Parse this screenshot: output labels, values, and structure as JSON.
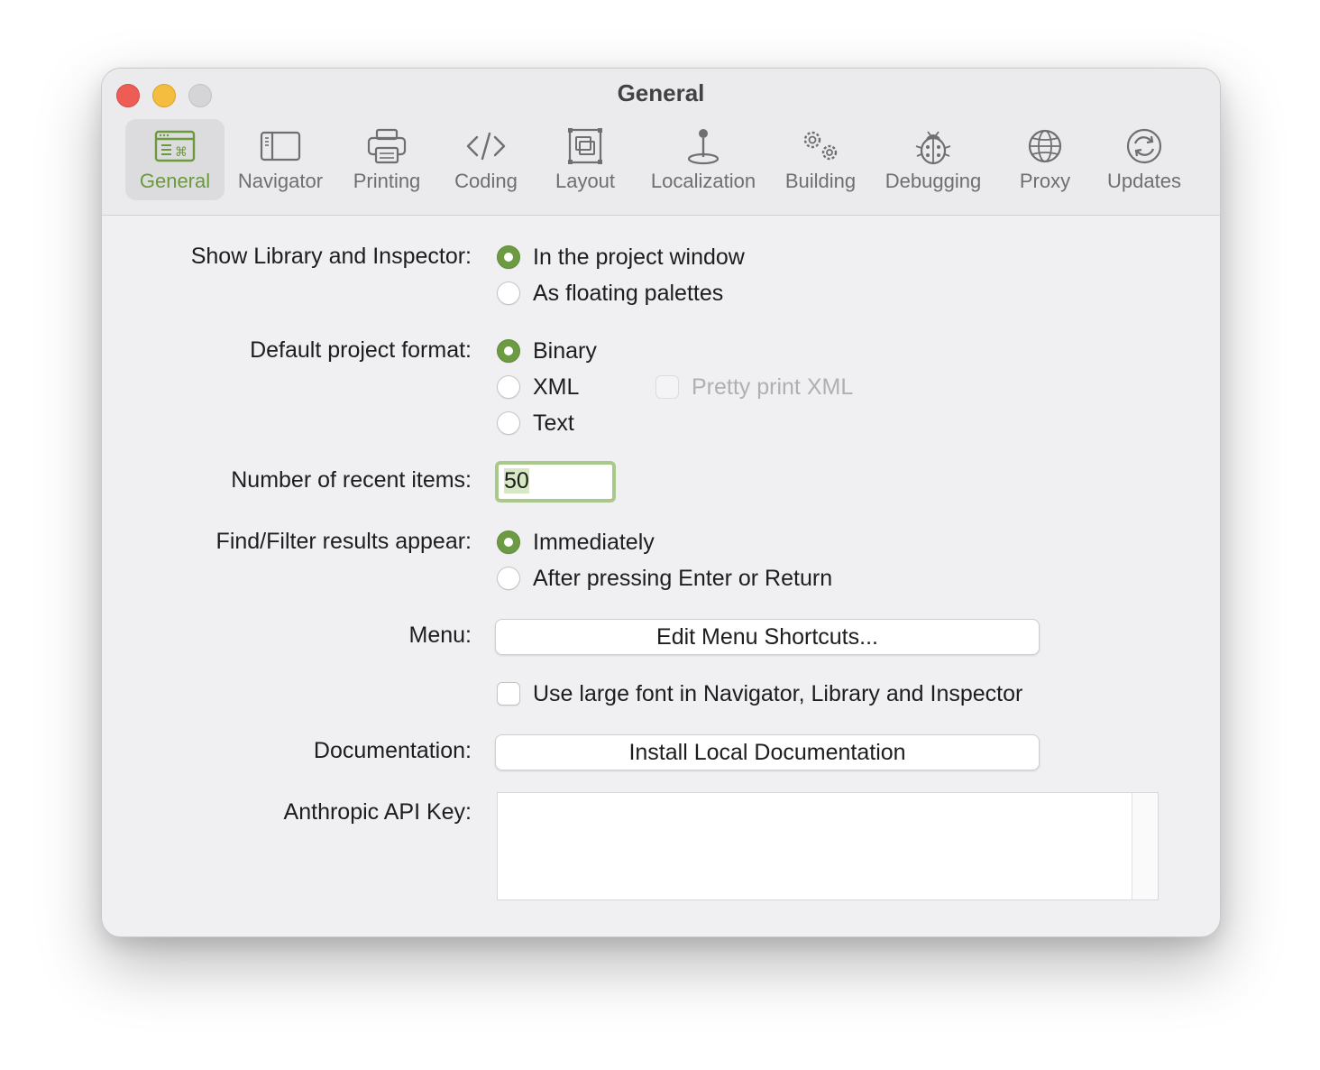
{
  "window": {
    "title": "General"
  },
  "toolbar": {
    "items": [
      {
        "label": "General",
        "icon": "general-icon",
        "selected": true
      },
      {
        "label": "Navigator",
        "icon": "sidebar-icon"
      },
      {
        "label": "Printing",
        "icon": "printer-icon"
      },
      {
        "label": "Coding",
        "icon": "code-icon"
      },
      {
        "label": "Layout",
        "icon": "layout-icon"
      },
      {
        "label": "Localization",
        "icon": "location-pin-icon"
      },
      {
        "label": "Building",
        "icon": "gears-icon"
      },
      {
        "label": "Debugging",
        "icon": "ladybug-icon"
      },
      {
        "label": "Proxy",
        "icon": "globe-icon"
      },
      {
        "label": "Updates",
        "icon": "refresh-icon"
      }
    ]
  },
  "settings": {
    "library": {
      "label": "Show Library and Inspector:",
      "options": [
        "In the project window",
        "As floating palettes"
      ],
      "selected": "In the project window"
    },
    "format": {
      "label": "Default project format:",
      "options": [
        "Binary",
        "XML",
        "Text"
      ],
      "selected": "Binary",
      "pretty_print_label": "Pretty print XML"
    },
    "recent": {
      "label": "Number of recent items:",
      "value": "50"
    },
    "find": {
      "label": "Find/Filter results appear:",
      "options": [
        "Immediately",
        "After pressing Enter or Return"
      ],
      "selected": "Immediately"
    },
    "menu": {
      "label": "Menu:",
      "button": "Edit Menu Shortcuts..."
    },
    "large_font": {
      "label": "Use large font in Navigator, Library and Inspector"
    },
    "documentation": {
      "label": "Documentation:",
      "button": "Install Local Documentation"
    },
    "api_key": {
      "label": "Anthropic API Key:",
      "value": ""
    }
  },
  "colors": {
    "accent": "#6d9b43",
    "selected_tab_text": "#6b9a3b"
  }
}
